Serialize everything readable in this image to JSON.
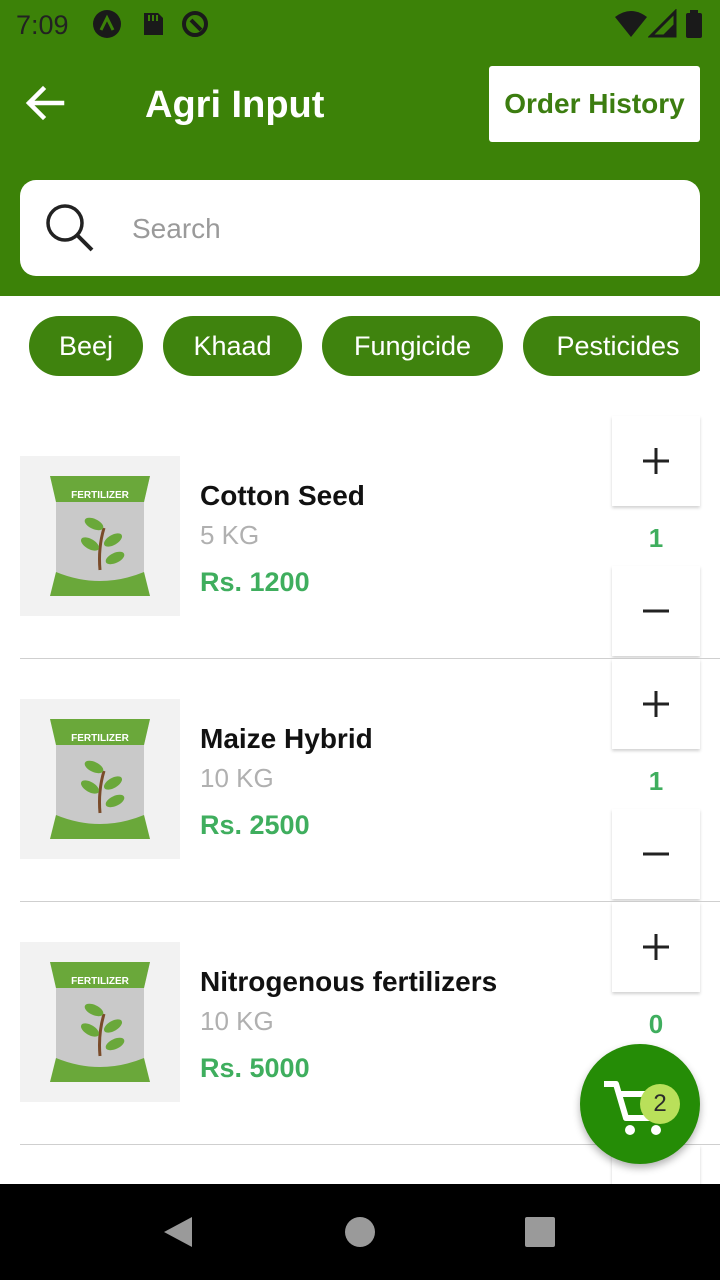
{
  "status_bar": {
    "time": "7:09"
  },
  "appbar": {
    "title": "Agri Input",
    "order_history_label": "Order History"
  },
  "search": {
    "placeholder": "Search"
  },
  "categories": [
    "Beej",
    "Khaad",
    "Fungicide",
    "Pesticides"
  ],
  "products": [
    {
      "name": "Cotton Seed",
      "weight": "5 KG",
      "price": "Rs. 1200",
      "qty": "1",
      "bag_label": "FERTILIZER"
    },
    {
      "name": "Maize Hybrid",
      "weight": "10 KG",
      "price": "Rs. 2500",
      "qty": "1",
      "bag_label": "FERTILIZER"
    },
    {
      "name": "Nitrogenous fertilizers",
      "weight": "10 KG",
      "price": "Rs. 5000",
      "qty": "0",
      "bag_label": "FERTILIZER"
    }
  ],
  "cart": {
    "count": "2"
  },
  "colors": {
    "primary": "#3c8208",
    "price": "#3fae5e",
    "fab": "#258c06",
    "badge": "#b9e05a"
  }
}
